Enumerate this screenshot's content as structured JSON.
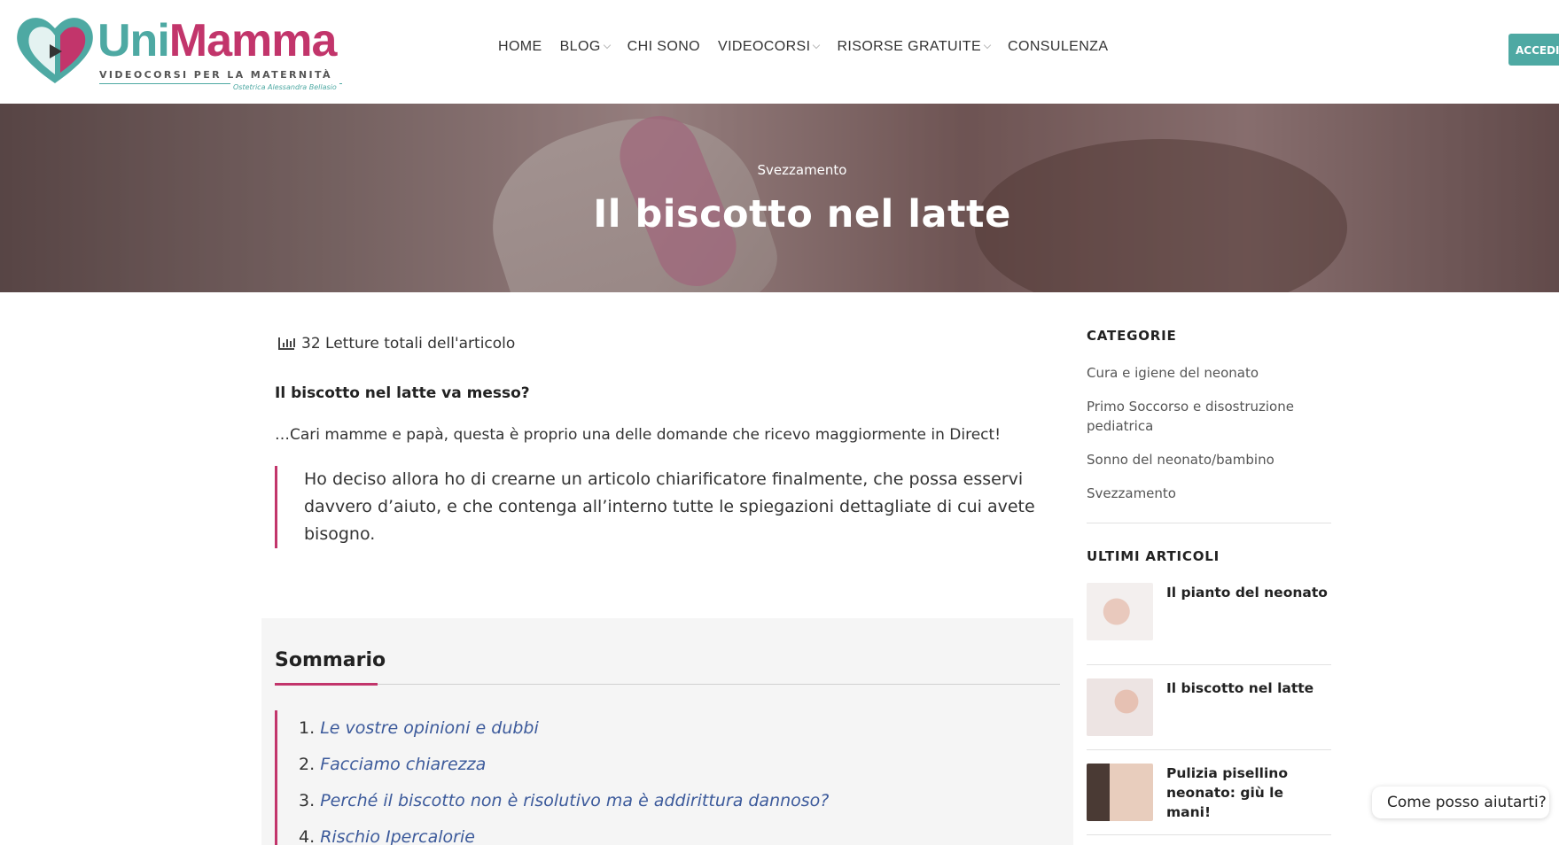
{
  "brand": {
    "name_part1": "Uni",
    "name_part2": "Mamma",
    "tagline": "VIDEOCORSI PER LA MATERNITÀ",
    "signature": "Ostetrica Alessandra Bellasio"
  },
  "nav": {
    "items": [
      {
        "label": "HOME",
        "has_dropdown": false
      },
      {
        "label": "BLOG",
        "has_dropdown": true
      },
      {
        "label": "CHI SONO",
        "has_dropdown": false
      },
      {
        "label": "VIDEOCORSI",
        "has_dropdown": true
      },
      {
        "label": "RISORSE GRATUITE",
        "has_dropdown": true
      },
      {
        "label": "CONSULENZA",
        "has_dropdown": false
      }
    ],
    "cta_label": "ACCEDI"
  },
  "hero": {
    "category": "Svezzamento",
    "title": "Il biscotto nel latte"
  },
  "article": {
    "reads": "32 Letture totali dell'articolo",
    "question": "Il biscotto nel latte va messo?",
    "intro": "…Cari mamme e papà, questa è proprio una delle domande che ricevo maggiormente in Direct!",
    "quote": "Ho deciso allora ho di crearne un articolo chiarificatore finalmente, che possa esservi davvero d’aiuto, e che contenga all’interno tutte le spiegazioni dettagliate di cui avete bisogno."
  },
  "toc": {
    "title": "Sommario",
    "items": [
      {
        "num": "1.",
        "label": "Le vostre opinioni e dubbi"
      },
      {
        "num": "2.",
        "label": "Facciamo chiarezza"
      },
      {
        "num": "3.",
        "label": "Perché il biscotto non è risolutivo ma è addirittura dannoso?"
      },
      {
        "num": "4.",
        "label": "Rischio Ipercalorie"
      }
    ]
  },
  "sidebar": {
    "categories_title": "CATEGORIE",
    "categories": [
      "Cura e igiene del neonato",
      "Primo Soccorso e disostruzione pediatrica",
      "Sonno del neonato/bambino",
      "Svezzamento"
    ],
    "latest_title": "ULTIMI ARTICOLI",
    "latest": [
      {
        "title": "Il pianto del neonato"
      },
      {
        "title": "Il biscotto nel latte"
      },
      {
        "title": "Pulizia pisellino neonato: giù le mani!"
      }
    ]
  },
  "chat": {
    "label": "Come posso aiutarti?"
  },
  "colors": {
    "teal": "#4ea9a3",
    "pink": "#c2356b",
    "link": "#3c5a9b"
  }
}
